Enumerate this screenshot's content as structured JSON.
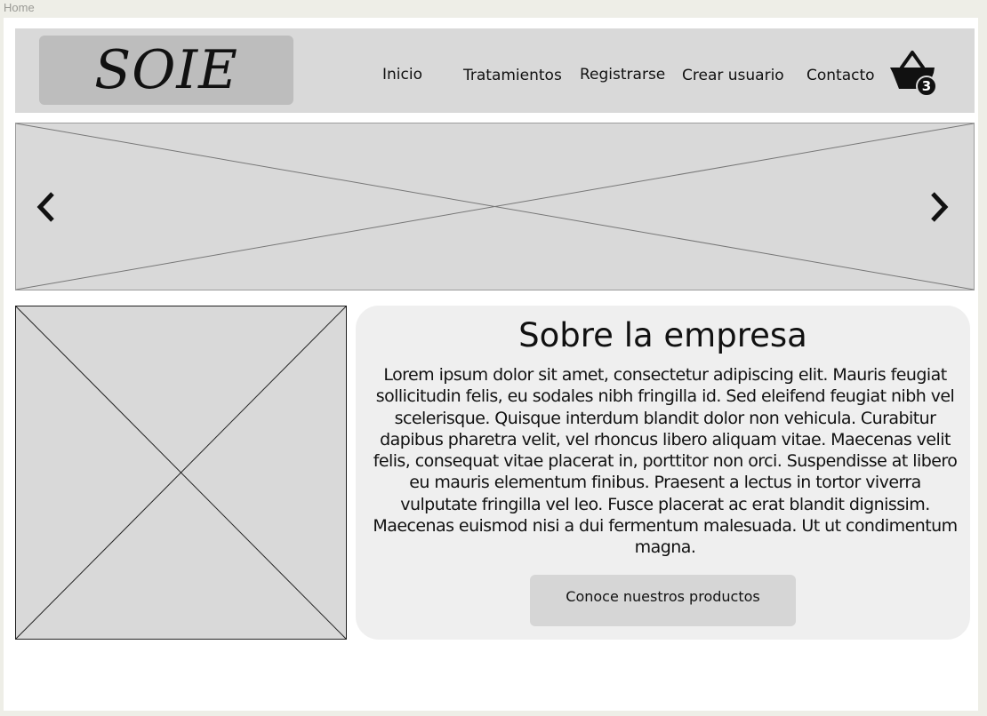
{
  "frame": {
    "label": "Home"
  },
  "header": {
    "logo": "SOIE",
    "nav": [
      {
        "label": "Inicio"
      },
      {
        "label": "Tratamientos"
      },
      {
        "label": "Registrarse"
      },
      {
        "label": "Crear usuario"
      },
      {
        "label": "Contacto"
      }
    ],
    "cart": {
      "icon": "shopping-basket-icon",
      "count": "3"
    }
  },
  "carousel": {
    "prev_icon": "chevron-left-icon",
    "next_icon": "chevron-right-icon"
  },
  "about": {
    "title": "Sobre la empresa",
    "body": "Lorem ipsum dolor sit amet, consectetur adipiscing elit. Mauris feugiat sollicitudin felis, eu sodales nibh fringilla id. Sed eleifend feugiat nibh vel scelerisque. Quisque interdum blandit dolor non vehicula. Curabitur dapibus pharetra velit, vel rhoncus libero aliquam vitae. Maecenas velit felis, consequat vitae placerat in, porttitor non orci. Suspendisse at libero eu mauris elementum finibus. Praesent a lectus in tortor viverra vulputate fringilla vel leo. Fusce placerat ac erat blandit dignissim. Maecenas euismod nisi a dui fermentum malesuada. Ut ut condimentum magna.",
    "button_label": "Conoce nuestros productos"
  },
  "colors": {
    "page_bg": "#eeeee7",
    "header_bg": "#d9d9d9",
    "logo_bg": "#bdbdbd",
    "card_bg": "#efefef",
    "button_bg": "#d6d6d6"
  }
}
